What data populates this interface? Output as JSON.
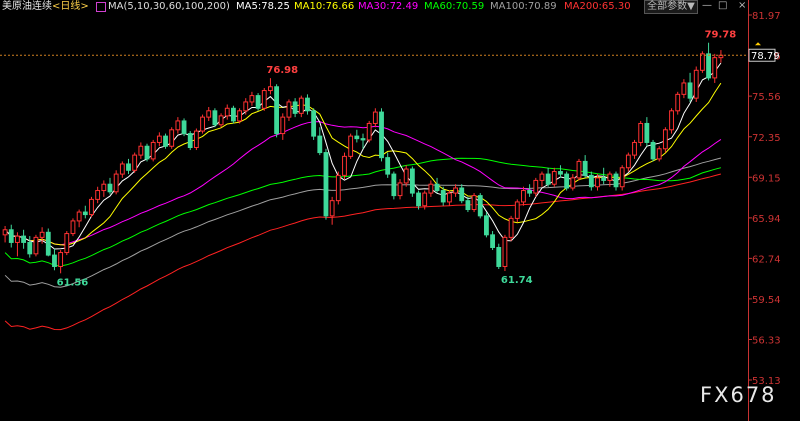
{
  "header": {
    "instrument": "美原油连续",
    "period": "<日线>",
    "ma_spec": "MA(5,10,30,60,100,200)",
    "ma5": "MA5:78.25",
    "ma10": "MA10:76.66",
    "ma30": "MA30:72.49",
    "ma60": "MA60:70.59",
    "ma100": "MA100:70.89",
    "ma200": "MA200:65.30",
    "all_button": "全部参数▼",
    "tool_minus": "—",
    "tool_square": "□",
    "tool_close": "×"
  },
  "watermark": "FX678",
  "colors": {
    "ma5": "#ffffff",
    "ma10": "#ffff00",
    "ma30": "#ff00ff",
    "ma60": "#00ff00",
    "ma100": "#a0a0a0",
    "ma200": "#ff2222",
    "up": "#ff3232",
    "down": "#3fd99a",
    "axis": "#c83232"
  },
  "chart_data": {
    "type": "candlestick",
    "yticks": [
      "81.97",
      "78.76",
      "75.56",
      "72.35",
      "69.15",
      "65.94",
      "62.74",
      "59.54",
      "56.33",
      "53.13"
    ],
    "last_price": "78.79",
    "ylim": [
      53.13,
      81.97
    ],
    "annotations": [
      {
        "text": "79.78",
        "bar": 114,
        "value": 79.78,
        "kind": "high"
      },
      {
        "text": "76.98",
        "bar": 43,
        "value": 76.98,
        "kind": "high"
      },
      {
        "text": "61.56",
        "bar": 9,
        "value": 61.56,
        "kind": "low"
      },
      {
        "text": "61.74",
        "bar": 81,
        "value": 61.74,
        "kind": "low"
      }
    ],
    "candles": [
      [
        64.6,
        65.3,
        64.0,
        65.0
      ],
      [
        65.0,
        65.4,
        63.6,
        64.0
      ],
      [
        64.0,
        64.8,
        62.9,
        64.5
      ],
      [
        64.5,
        65.0,
        63.5,
        64.0
      ],
      [
        64.0,
        64.5,
        62.8,
        63.1
      ],
      [
        63.1,
        64.6,
        62.9,
        64.4
      ],
      [
        64.4,
        65.2,
        63.9,
        64.8
      ],
      [
        64.8,
        65.1,
        62.9,
        63.0
      ],
      [
        63.0,
        63.5,
        61.8,
        62.1
      ],
      [
        62.1,
        63.4,
        61.56,
        63.2
      ],
      [
        63.2,
        64.9,
        63.0,
        64.7
      ],
      [
        64.7,
        65.9,
        64.5,
        65.7
      ],
      [
        65.7,
        66.6,
        65.2,
        66.4
      ],
      [
        66.4,
        66.9,
        65.9,
        66.2
      ],
      [
        66.2,
        67.6,
        66.0,
        67.4
      ],
      [
        67.4,
        68.4,
        67.1,
        68.1
      ],
      [
        68.1,
        68.9,
        67.6,
        68.6
      ],
      [
        68.6,
        69.1,
        67.8,
        68.0
      ],
      [
        68.0,
        69.7,
        67.8,
        69.4
      ],
      [
        69.4,
        70.4,
        69.1,
        70.2
      ],
      [
        70.2,
        70.6,
        69.4,
        69.7
      ],
      [
        69.7,
        71.1,
        69.5,
        70.9
      ],
      [
        70.9,
        71.9,
        70.6,
        71.6
      ],
      [
        71.6,
        71.8,
        70.4,
        70.6
      ],
      [
        70.6,
        72.1,
        70.4,
        71.9
      ],
      [
        71.9,
        72.7,
        71.6,
        72.4
      ],
      [
        72.4,
        72.6,
        71.4,
        71.6
      ],
      [
        71.6,
        73.1,
        71.4,
        72.9
      ],
      [
        72.9,
        73.9,
        72.6,
        73.6
      ],
      [
        73.6,
        73.8,
        72.4,
        72.6
      ],
      [
        72.6,
        72.8,
        71.3,
        71.5
      ],
      [
        71.5,
        73.0,
        71.3,
        72.8
      ],
      [
        72.8,
        74.1,
        72.6,
        73.9
      ],
      [
        73.9,
        74.7,
        73.6,
        74.4
      ],
      [
        74.4,
        74.6,
        73.1,
        73.3
      ],
      [
        73.3,
        74.2,
        73.1,
        74.0
      ],
      [
        74.0,
        74.9,
        73.7,
        74.6
      ],
      [
        74.6,
        74.8,
        73.4,
        73.6
      ],
      [
        73.6,
        74.6,
        73.4,
        74.4
      ],
      [
        74.4,
        75.4,
        74.1,
        75.1
      ],
      [
        75.1,
        75.9,
        74.8,
        75.6
      ],
      [
        75.6,
        75.8,
        74.4,
        74.6
      ],
      [
        74.6,
        76.2,
        74.4,
        76.0
      ],
      [
        76.0,
        76.98,
        75.7,
        76.3
      ],
      [
        76.3,
        76.5,
        72.3,
        72.6
      ],
      [
        72.6,
        74.2,
        72.1,
        73.9
      ],
      [
        73.9,
        75.3,
        73.6,
        75.1
      ],
      [
        75.1,
        75.4,
        73.9,
        74.2
      ],
      [
        74.2,
        75.6,
        73.9,
        75.4
      ],
      [
        75.4,
        75.7,
        74.1,
        74.4
      ],
      [
        74.4,
        74.6,
        72.1,
        72.4
      ],
      [
        72.4,
        73.1,
        70.9,
        71.1
      ],
      [
        71.1,
        71.4,
        65.8,
        66.1
      ],
      [
        66.1,
        67.6,
        65.4,
        67.3
      ],
      [
        67.3,
        69.6,
        67.0,
        69.3
      ],
      [
        69.3,
        71.1,
        69.0,
        70.8
      ],
      [
        70.8,
        72.6,
        70.6,
        72.4
      ],
      [
        72.4,
        72.9,
        71.9,
        72.2
      ],
      [
        72.2,
        72.6,
        71.4,
        72.1
      ],
      [
        72.1,
        73.6,
        71.9,
        73.4
      ],
      [
        73.4,
        74.6,
        73.1,
        74.3
      ],
      [
        74.3,
        74.6,
        70.4,
        70.7
      ],
      [
        70.7,
        71.1,
        69.1,
        69.4
      ],
      [
        69.4,
        69.6,
        67.4,
        67.7
      ],
      [
        67.7,
        69.0,
        67.4,
        68.7
      ],
      [
        68.7,
        70.1,
        68.4,
        69.8
      ],
      [
        69.8,
        70.0,
        67.6,
        67.9
      ],
      [
        67.9,
        68.1,
        66.6,
        66.9
      ],
      [
        66.9,
        68.1,
        66.6,
        67.9
      ],
      [
        67.9,
        68.9,
        67.6,
        68.6
      ],
      [
        68.6,
        69.1,
        67.9,
        68.1
      ],
      [
        68.1,
        68.4,
        66.9,
        67.2
      ],
      [
        67.2,
        68.1,
        66.9,
        67.9
      ],
      [
        67.9,
        68.6,
        67.6,
        68.3
      ],
      [
        68.3,
        68.6,
        67.1,
        67.3
      ],
      [
        67.3,
        67.6,
        66.4,
        66.6
      ],
      [
        66.6,
        67.9,
        66.4,
        67.7
      ],
      [
        67.7,
        67.9,
        65.9,
        66.1
      ],
      [
        66.1,
        66.4,
        64.4,
        64.6
      ],
      [
        64.6,
        64.9,
        63.4,
        63.6
      ],
      [
        63.6,
        63.9,
        61.9,
        62.1
      ],
      [
        62.1,
        64.6,
        61.74,
        64.4
      ],
      [
        64.4,
        66.1,
        64.1,
        65.9
      ],
      [
        65.9,
        67.4,
        65.6,
        67.2
      ],
      [
        67.2,
        68.4,
        66.9,
        68.1
      ],
      [
        68.1,
        68.6,
        67.6,
        67.9
      ],
      [
        67.9,
        69.1,
        67.6,
        68.9
      ],
      [
        68.9,
        69.6,
        68.4,
        69.4
      ],
      [
        69.4,
        69.9,
        68.4,
        68.6
      ],
      [
        68.6,
        69.9,
        68.4,
        69.6
      ],
      [
        69.6,
        70.1,
        69.1,
        69.4
      ],
      [
        69.4,
        69.6,
        68.1,
        68.3
      ],
      [
        68.3,
        69.4,
        68.1,
        69.1
      ],
      [
        69.1,
        70.6,
        68.9,
        70.4
      ],
      [
        70.4,
        70.9,
        69.1,
        69.3
      ],
      [
        69.3,
        69.6,
        68.1,
        68.4
      ],
      [
        68.4,
        69.4,
        68.1,
        69.1
      ],
      [
        69.1,
        69.9,
        68.6,
        68.9
      ],
      [
        68.9,
        69.6,
        68.4,
        69.4
      ],
      [
        69.4,
        69.6,
        68.1,
        68.4
      ],
      [
        68.4,
        70.1,
        68.1,
        69.9
      ],
      [
        69.9,
        71.1,
        69.6,
        70.9
      ],
      [
        70.9,
        72.1,
        70.6,
        71.9
      ],
      [
        71.9,
        73.6,
        71.6,
        73.4
      ],
      [
        73.4,
        73.9,
        71.6,
        71.9
      ],
      [
        71.9,
        72.1,
        70.4,
        70.6
      ],
      [
        70.6,
        71.6,
        70.4,
        71.4
      ],
      [
        71.4,
        73.1,
        71.1,
        72.9
      ],
      [
        72.9,
        74.6,
        72.6,
        74.4
      ],
      [
        74.4,
        75.9,
        74.1,
        75.7
      ],
      [
        75.7,
        76.9,
        75.4,
        76.6
      ],
      [
        76.6,
        77.4,
        75.1,
        75.4
      ],
      [
        75.4,
        77.9,
        75.1,
        77.6
      ],
      [
        77.6,
        79.1,
        77.4,
        78.9
      ],
      [
        78.9,
        79.78,
        76.8,
        77.0
      ],
      [
        77.0,
        78.9,
        76.6,
        78.6
      ],
      [
        78.6,
        79.2,
        78.2,
        78.79
      ]
    ]
  }
}
